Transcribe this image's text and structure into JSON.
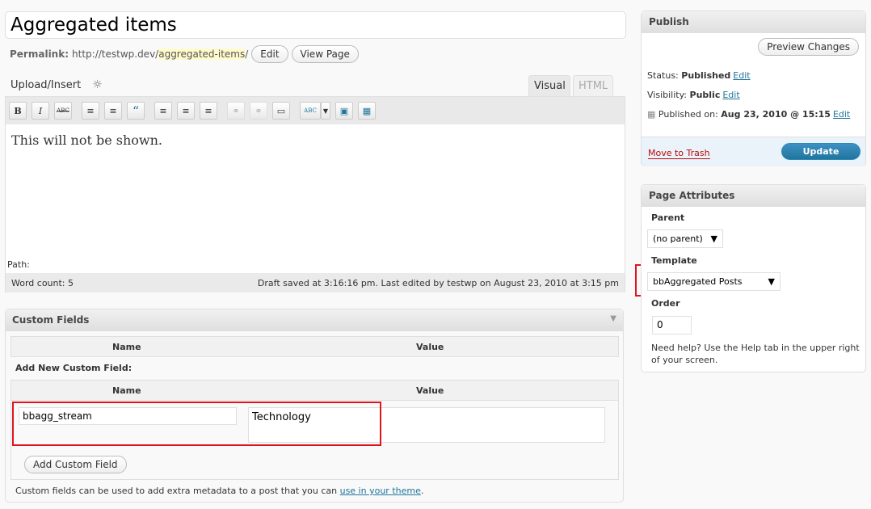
{
  "post": {
    "title": "Aggregated items",
    "permalink_label": "Permalink:",
    "permalink_base": "http://testwp.dev/",
    "permalink_slug": "aggregated-items",
    "permalink_trail": "/",
    "edit_label": "Edit",
    "view_page_label": "View Page"
  },
  "editor": {
    "upload_insert": "Upload/Insert",
    "tab_visual": "Visual",
    "tab_html": "HTML",
    "content": "This will  not be shown.",
    "path_label": "Path:",
    "word_count": "Word count: 5",
    "draft_status": "Draft saved at 3:16:16 pm. Last edited by testwp on August 23, 2010 at 3:15 pm",
    "toolbar": {
      "bold": "B",
      "italic": "I",
      "strike": "ABC",
      "bullets": "≡",
      "numbers": "≡",
      "quote": "“",
      "align_left": "≡",
      "align_center": "≡",
      "align_right": "≡",
      "link": "⚭",
      "unlink": "⚭",
      "more": "▭",
      "spell": "ABC",
      "fullscreen": "▣",
      "kitchen_sink": "▦"
    }
  },
  "custom_fields": {
    "title": "Custom Fields",
    "col_name": "Name",
    "col_value": "Value",
    "add_new_label": "Add New Custom Field:",
    "new_name_value": "bbagg_stream",
    "new_value_value": "Technology",
    "add_button": "Add Custom Field",
    "note_prefix": "Custom fields can be used to add extra metadata to a post that you can ",
    "note_link": "use in your theme",
    "note_suffix": "."
  },
  "publish": {
    "title": "Publish",
    "preview_button": "Preview Changes",
    "status_label": "Status:",
    "status_value": "Published",
    "visibility_label": "Visibility:",
    "visibility_value": "Public",
    "published_on_label": "Published on:",
    "published_on_value": "Aug 23, 2010 @ 15:15",
    "edit_link": "Edit",
    "trash_link": "Move to Trash",
    "update_button": "Update"
  },
  "page_attributes": {
    "title": "Page Attributes",
    "parent_label": "Parent",
    "parent_value": "(no parent)",
    "template_label": "Template",
    "template_value": "bbAggregated Posts",
    "order_label": "Order",
    "order_value": "0",
    "help_text": "Need help? Use the Help tab in the upper right of your screen."
  },
  "colors": {
    "link": "#21759b",
    "highlight_box": "#e0141e",
    "update_button": "#21759b",
    "trash_link": "#bc0b0b"
  }
}
